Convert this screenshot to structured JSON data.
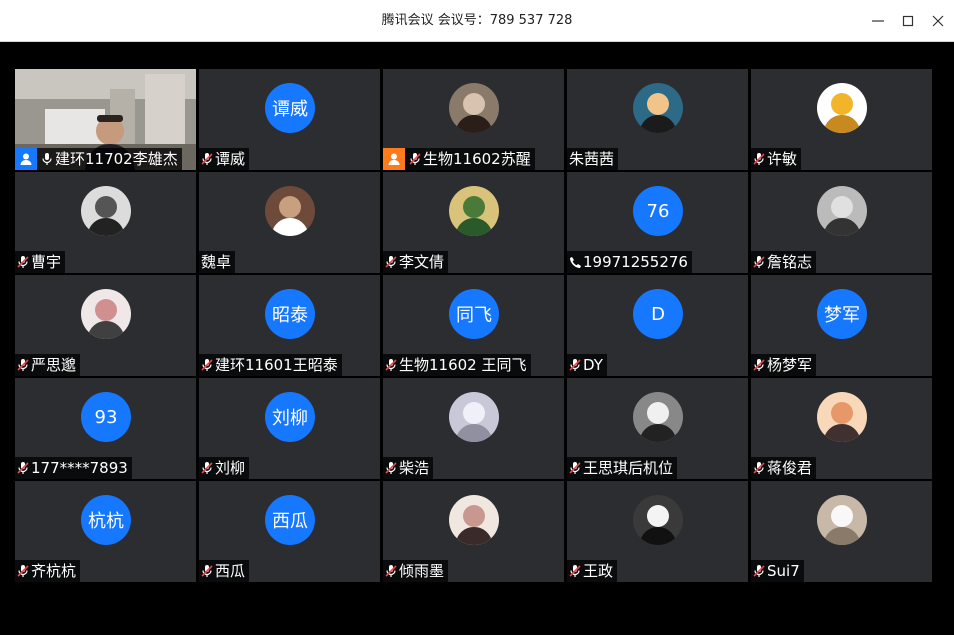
{
  "window": {
    "title": "腾讯会议 会议号：789 537 728",
    "controls": [
      "minimize-icon",
      "maximize-icon",
      "close-icon"
    ]
  },
  "participants": [
    {
      "name": "建环11702李雄杰",
      "status": "mic-on",
      "badge": "host",
      "video": true
    },
    {
      "name": "谭威",
      "status": "muted",
      "avatar_text": "谭威"
    },
    {
      "name": "生物11602苏醒",
      "status": "muted",
      "badge": "cohost",
      "avatar": "photo"
    },
    {
      "name": "朱茜茜",
      "status": "none",
      "avatar": "photo"
    },
    {
      "name": "许敏",
      "status": "muted",
      "avatar": "photo"
    },
    {
      "name": "曹宇",
      "status": "muted",
      "avatar": "photo"
    },
    {
      "name": "魏卓",
      "status": "none",
      "avatar": "photo"
    },
    {
      "name": "李文倩",
      "status": "muted",
      "avatar": "photo"
    },
    {
      "name": "19971255276",
      "status": "phone",
      "avatar_text": "76"
    },
    {
      "name": "詹铭志",
      "status": "muted",
      "avatar": "photo"
    },
    {
      "name": "严思邈",
      "status": "muted",
      "avatar": "photo"
    },
    {
      "name": "建环11601王昭泰",
      "status": "muted",
      "avatar_text": "昭泰"
    },
    {
      "name": "生物11602 王同飞",
      "status": "muted",
      "avatar_text": "同飞"
    },
    {
      "name": "DY",
      "status": "muted",
      "avatar_text": "D"
    },
    {
      "name": "杨梦军",
      "status": "muted",
      "avatar_text": "梦军"
    },
    {
      "name": "177****7893",
      "status": "muted",
      "avatar_text": "93"
    },
    {
      "name": "刘柳",
      "status": "muted",
      "avatar_text": "刘柳"
    },
    {
      "name": "柴浩",
      "status": "muted",
      "avatar": "photo"
    },
    {
      "name": "王思琪后机位",
      "status": "muted",
      "avatar": "photo"
    },
    {
      "name": "蒋俊君",
      "status": "muted",
      "avatar": "photo"
    },
    {
      "name": "齐杭杭",
      "status": "muted",
      "avatar_text": "杭杭"
    },
    {
      "name": "西瓜",
      "status": "muted",
      "avatar_text": "西瓜"
    },
    {
      "name": "倾雨墨",
      "status": "muted",
      "avatar": "photo"
    },
    {
      "name": "王政",
      "status": "muted",
      "avatar": "photo"
    },
    {
      "name": "Sui7",
      "status": "muted",
      "avatar": "photo"
    }
  ],
  "colors": {
    "tile_bg": "#2b2d31",
    "avatar_blue": "#1677ff",
    "host_blue": "#1677ff",
    "cohost_orange": "#ff7a1a",
    "muted_red": "#e5484d"
  }
}
